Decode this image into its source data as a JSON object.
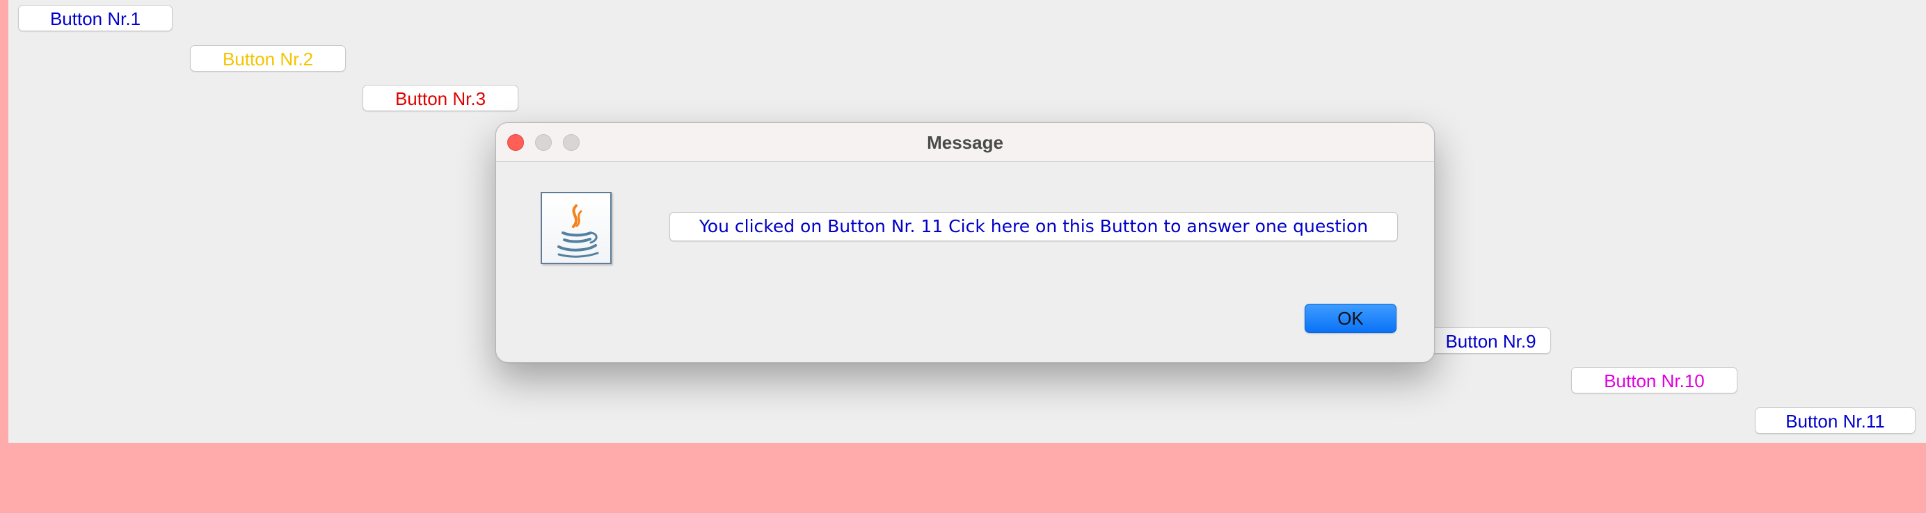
{
  "buttons": [
    {
      "label": "Button Nr.1",
      "color": "#0000cc"
    },
    {
      "label": "Button Nr.2",
      "color": "#f5c400"
    },
    {
      "label": "Button Nr.3",
      "color": "#e00000"
    },
    {
      "label": "Button Nr.9",
      "color": "#0000cc"
    },
    {
      "label": "Button Nr.10",
      "color": "#e000e0"
    },
    {
      "label": "Button Nr.11",
      "color": "#0000cc"
    }
  ],
  "dialog": {
    "title": "Message",
    "message": "You clicked on Button Nr. 11 Cick here on this Button to answer one question",
    "message_color": "#0000c8",
    "ok_label": "OK",
    "icon": "java-icon"
  },
  "colors": {
    "outer_background": "#ffabab",
    "panel_background": "#eeeeee",
    "ok_button": "#1079f7"
  }
}
